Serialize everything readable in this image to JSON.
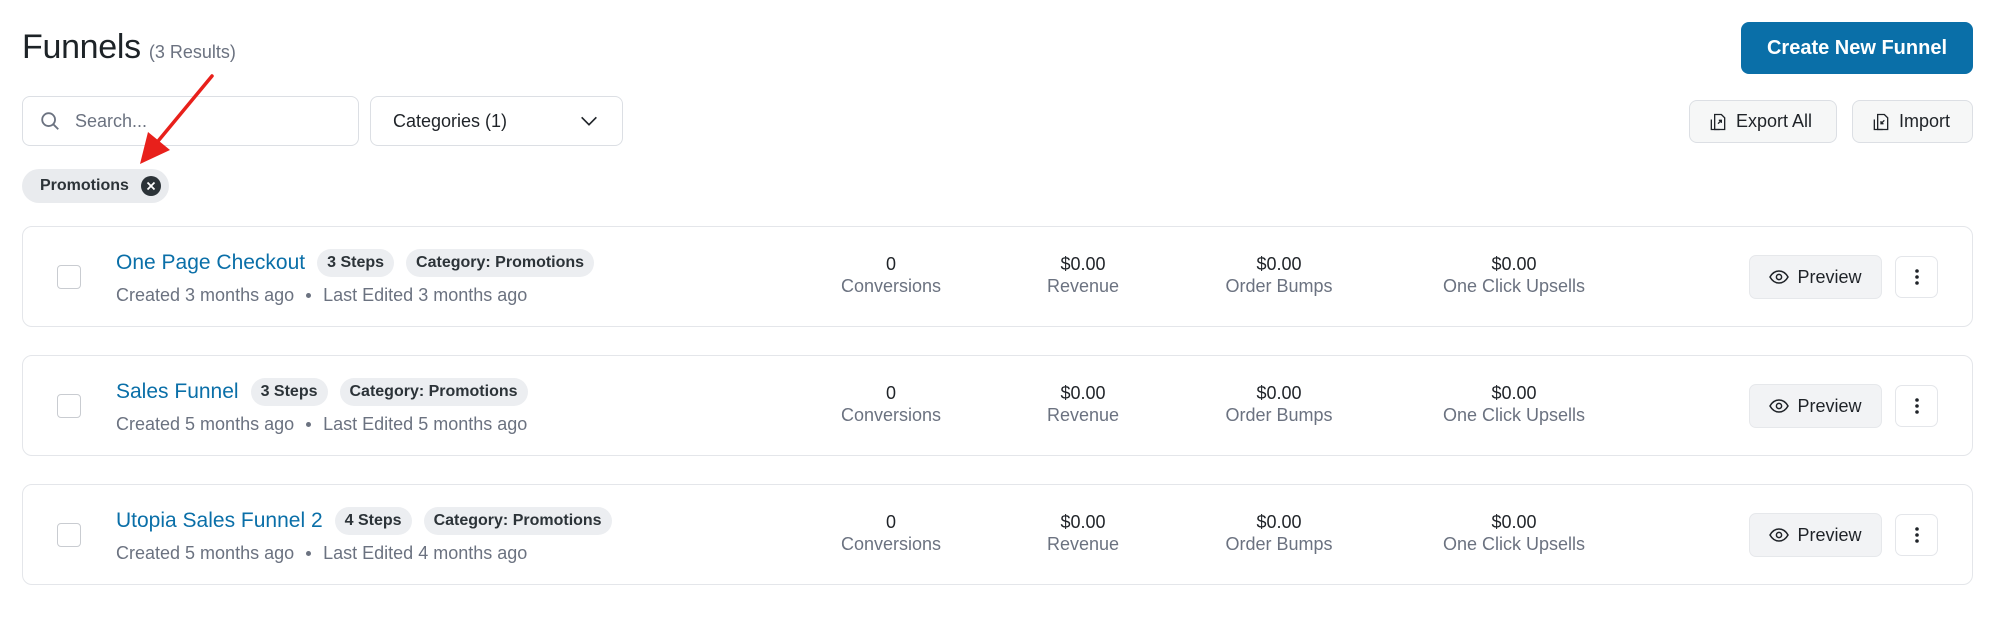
{
  "header": {
    "title": "Funnels",
    "result_count": "(3 Results)",
    "create_button": "Create New Funnel"
  },
  "search": {
    "placeholder": "Search..."
  },
  "categories_select": {
    "label": "Categories (1)"
  },
  "toolbar": {
    "export_label": "Export All",
    "import_label": "Import"
  },
  "active_filter": {
    "label": "Promotions"
  },
  "stat_labels": {
    "conversions": "Conversions",
    "revenue": "Revenue",
    "order_bumps": "Order Bumps",
    "upsells": "One Click Upsells"
  },
  "preview_label": "Preview",
  "funnels": [
    {
      "title": "One Page Checkout",
      "steps": "3 Steps",
      "category": "Category: Promotions",
      "created": "Created 3 months ago",
      "edited": "Last Edited 3 months ago",
      "conversions": "0",
      "revenue": "$0.00",
      "order_bumps": "$0.00",
      "upsells": "$0.00"
    },
    {
      "title": "Sales Funnel",
      "steps": "3 Steps",
      "category": "Category: Promotions",
      "created": "Created 5 months ago",
      "edited": "Last Edited 5 months ago",
      "conversions": "0",
      "revenue": "$0.00",
      "order_bumps": "$0.00",
      "upsells": "$0.00"
    },
    {
      "title": "Utopia Sales Funnel 2",
      "steps": "4 Steps",
      "category": "Category: Promotions",
      "created": "Created 5 months ago",
      "edited": "Last Edited 4 months ago",
      "conversions": "0",
      "revenue": "$0.00",
      "order_bumps": "$0.00",
      "upsells": "$0.00"
    }
  ],
  "colors": {
    "accent": "#0a6fa8",
    "annotation_arrow": "#e8201b"
  },
  "icons": {
    "search": "search-icon",
    "chevron": "chevron-down-icon",
    "export": "export-icon",
    "import": "import-icon",
    "close": "close-circle-icon",
    "preview": "eye-icon",
    "more": "more-vertical-icon"
  }
}
